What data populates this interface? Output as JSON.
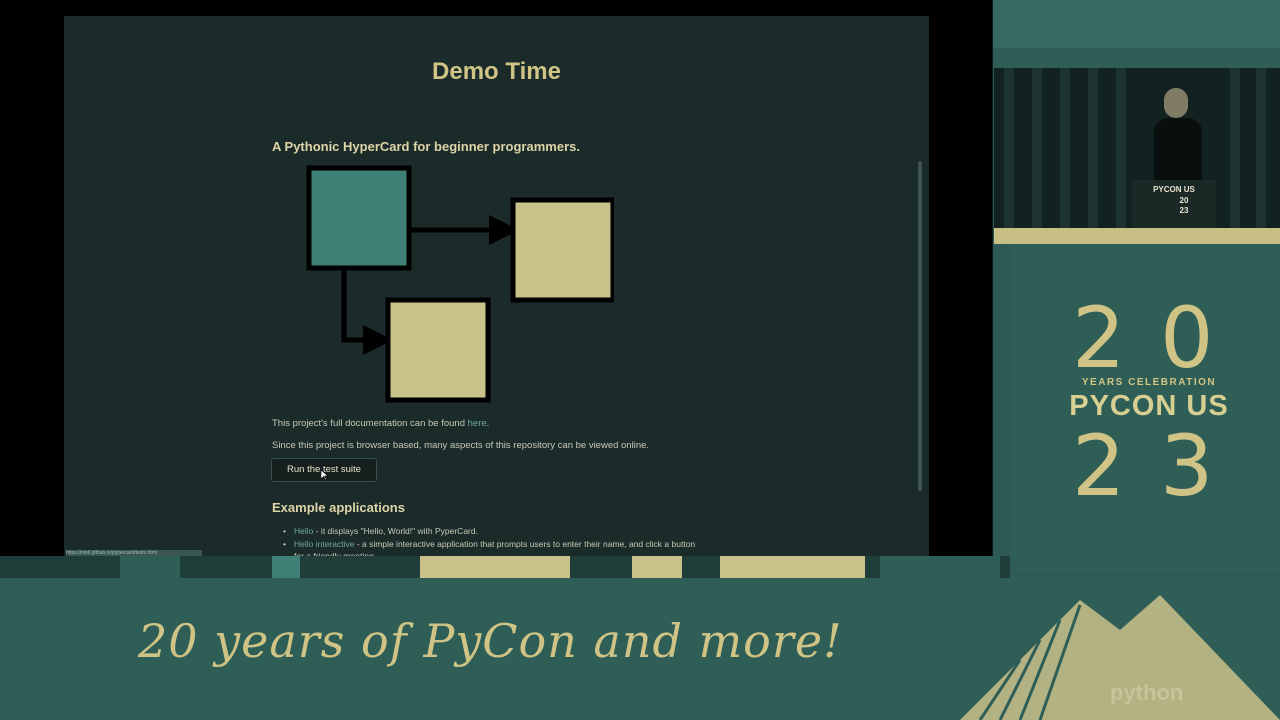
{
  "slide": {
    "title": "Demo Time",
    "subtitle": "A Pythonic HyperCard for beginner programmers.",
    "doc_text_before": "This project's full documentation can be found ",
    "doc_link": "here",
    "doc_text_after": ".",
    "browser_text": "Since this project is browser based, many aspects of this repository can be viewed online.",
    "run_button": "Run the test suite",
    "examples_heading": "Example applications",
    "examples": [
      {
        "link": "Hello",
        "text": " - it displays \"Hello, World!\" with PyperCard."
      },
      {
        "link": "Hello interactive",
        "text": " - a simple interactive application that prompts users to enter their name, and click a button for a friendly greeting."
      }
    ],
    "status_url": "https://ntoll.github.io/pypercard/tests.html"
  },
  "camera": {
    "podium_line1": "PYCON US",
    "podium_line2": "20",
    "podium_line3": "23"
  },
  "branding": {
    "digit_2a": "2",
    "digit_0": "0",
    "years_celebration": "YEARS CELEBRATION",
    "pycon_us": "PYCON US",
    "digit_2b": "2",
    "digit_3": "3",
    "tagline": "20 years of PyCon and more!",
    "sponsor": "python"
  },
  "colors": {
    "accent": "#cfc486",
    "teal": "#3e8076",
    "card_tan": "#c9c18a",
    "background": "#2e5a55"
  }
}
